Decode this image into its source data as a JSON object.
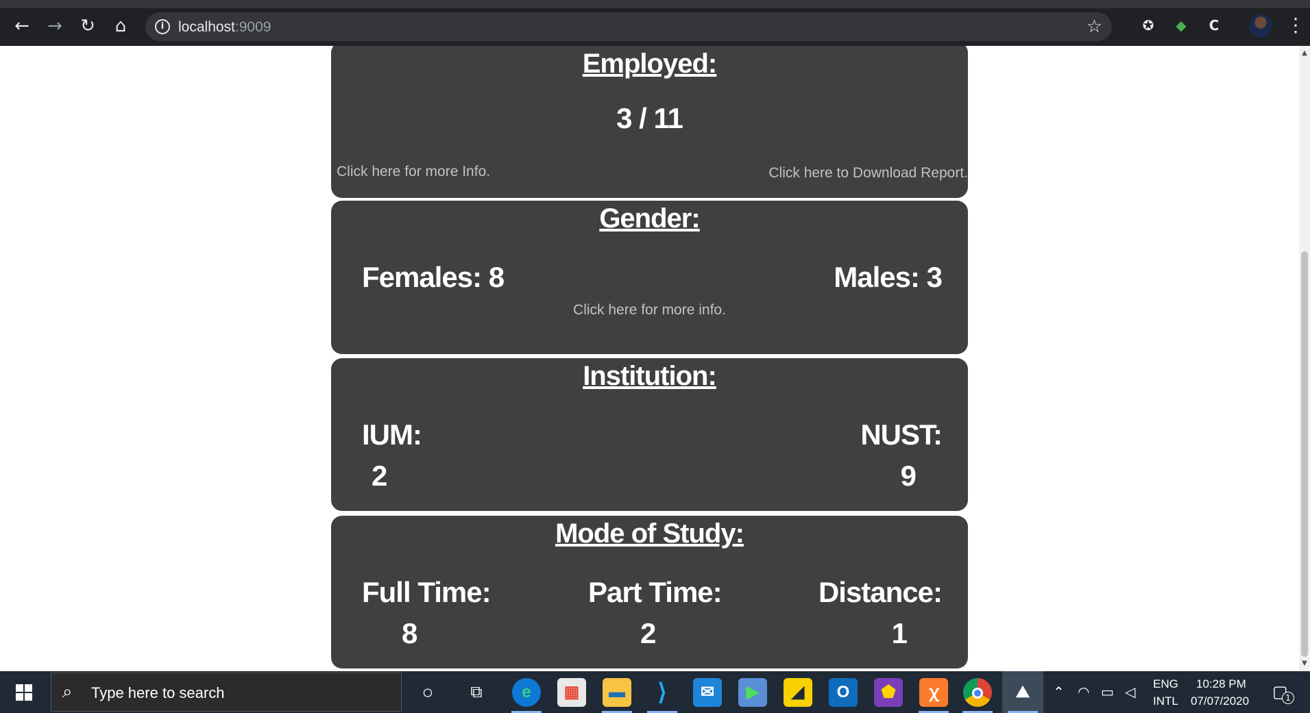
{
  "browser": {
    "url_host": "localhost",
    "url_port": ":9009"
  },
  "cards": {
    "employed": {
      "title": "Employed:",
      "value": "3 / 11",
      "more_info": "Click here for more Info.",
      "download": "Click here to Download Report."
    },
    "gender": {
      "title": "Gender:",
      "females": "Females: 8",
      "males": "Males: 3",
      "more_info": "Click here for more info."
    },
    "institution": {
      "title": "Institution:",
      "ium_label": "IUM:",
      "ium_value": "2",
      "nust_label": "NUST:",
      "nust_value": "9"
    },
    "mode": {
      "title": "Mode of Study:",
      "full_label": "Full Time:",
      "full_value": "8",
      "part_label": "Part Time:",
      "part_value": "2",
      "distance_label": "Distance:",
      "distance_value": "1"
    }
  },
  "taskbar": {
    "search_placeholder": "Type here to search",
    "lang_top": "ENG",
    "lang_bottom": "INTL",
    "time": "10:28 PM",
    "date": "07/07/2020",
    "notification_count": "1"
  },
  "colors": {
    "card_bg": "#404040",
    "browser_bg": "#202124",
    "taskbar_bg": "#1f2a36"
  }
}
